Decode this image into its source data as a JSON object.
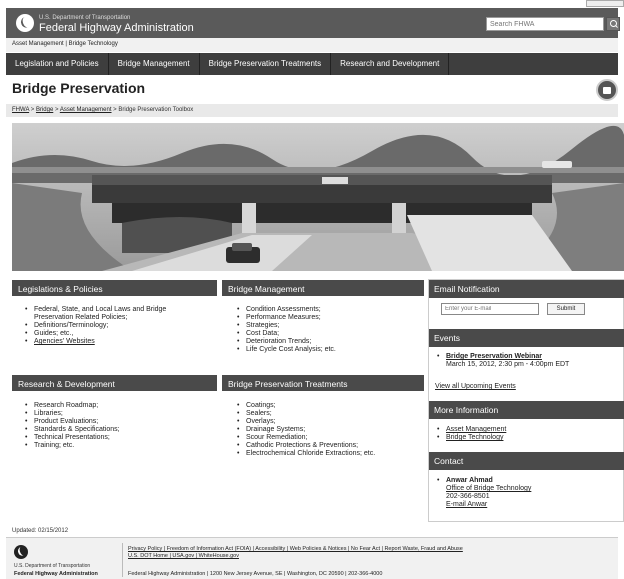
{
  "header": {
    "agency_small": "U.S. Department of Transportation",
    "agency_title": "Federal Highway Administration",
    "search_placeholder": "Search FHWA"
  },
  "subnav": {
    "text": "Asset Management | Bridge Technology"
  },
  "nav": {
    "items": [
      {
        "label": "Legislation and Policies"
      },
      {
        "label": "Bridge Management"
      },
      {
        "label": "Bridge Preservation Treatments"
      },
      {
        "label": "Research and Development"
      }
    ]
  },
  "page": {
    "title": "Bridge Preservation"
  },
  "breadcrumb": {
    "items": [
      "FHWA",
      "Bridge",
      "Asset Management",
      "Bridge Preservation Toolbox"
    ],
    "separator": " > "
  },
  "sections": {
    "legislation": {
      "title": "Legislations & Policies",
      "items": [
        "Federal, State, and Local Laws and Bridge",
        "Preservation Related Policies;",
        "Definitions/Terminology;",
        "Guides; etc.,",
        "Agencies' Websites"
      ]
    },
    "bridge_management": {
      "title": "Bridge Management",
      "items": [
        "Condition Assessments;",
        "Performance Measures;",
        "Strategies;",
        "Cost Data;",
        "Deterioration Trends;",
        "Life Cycle Cost Analysis; etc."
      ]
    },
    "research": {
      "title": "Research & Development",
      "items": [
        "Research Roadmap;",
        "Libraries;",
        "Product Evaluations;",
        "Standards & Specifications;",
        "Technical Presentations;",
        "Training; etc."
      ]
    },
    "treatments": {
      "title": "Bridge Preservation Treatments",
      "items": [
        "Coatings;",
        "Sealers;",
        "Overlays;",
        "Drainage Systems;",
        "Scour Remediation;",
        "Cathodic Protections & Preventions;",
        "Electrochemical Chloride Extractions; etc."
      ]
    }
  },
  "sidebar": {
    "email": {
      "title": "Email Notification",
      "placeholder": "Enter your E-mail",
      "submit_label": "Submit"
    },
    "events": {
      "title": "Events",
      "event_title": "Bridge Preservation Webinar",
      "event_date": "March 15, 2012, 2:30 pm - 4:00pm EDT",
      "view_all": "View all Upcoming Events"
    },
    "more_info": {
      "title": "More Information",
      "links": [
        "Asset Management",
        "Bridge Technology"
      ]
    },
    "contact": {
      "title": "Contact",
      "name": "Anwar Ahmad",
      "office": "Office of Bridge Technology",
      "phone": "202-366-8501",
      "email": "E-mail Anwar"
    }
  },
  "updated": "Updated: 02/15/2012",
  "footer": {
    "agency_small": "U.S. Department of Transportation",
    "agency": "Federal Highway Administration",
    "links_line": "Privacy Policy | Freedom of Information Act (FOIA) | Accessibility | Web Policies & Notices | No Fear Act | Report Waste, Fraud and Abuse",
    "links_line2": "U.S. DOT Home | USA.gov | WhiteHouse.gov",
    "address_line": "Federal Highway Administration | 1200 New Jersey Avenue, SE | Washington, DC 20590 | 202-366-4000"
  }
}
